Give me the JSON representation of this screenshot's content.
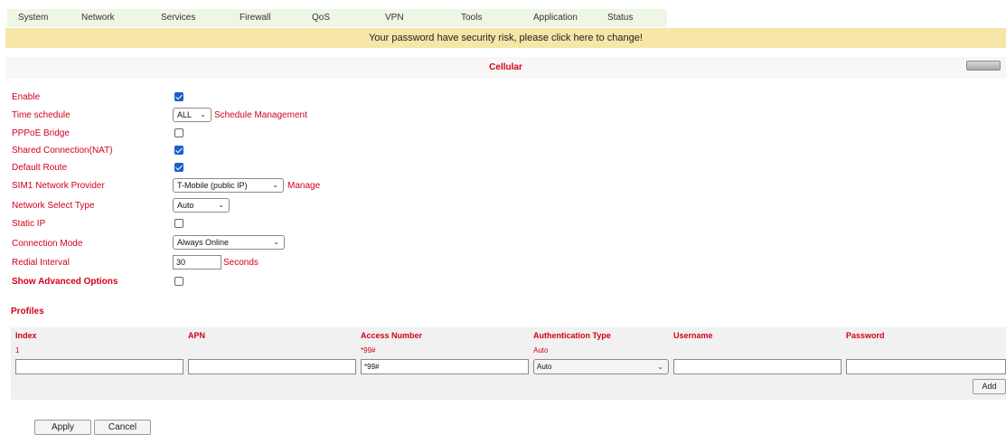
{
  "nav": {
    "items": [
      "System",
      "Network",
      "Services",
      "Firewall",
      "QoS",
      "VPN",
      "Tools",
      "Application",
      "Status"
    ]
  },
  "banner": {
    "text": "Your password have security risk, please click here to change!"
  },
  "section": {
    "title": "Cellular"
  },
  "form": {
    "enable": {
      "label": "Enable",
      "checked": true
    },
    "time_schedule": {
      "label": "Time schedule",
      "value": "ALL",
      "link": "Schedule Management"
    },
    "pppoe_bridge": {
      "label": "PPPoE Bridge",
      "checked": false
    },
    "shared_connection": {
      "label": "Shared Connection(NAT)",
      "checked": true
    },
    "default_route": {
      "label": "Default Route",
      "checked": true
    },
    "sim1_provider": {
      "label": "SIM1 Network Provider",
      "value": "T-Mobile (public IP)",
      "link": "Manage"
    },
    "network_select_type": {
      "label": "Network Select Type",
      "value": "Auto"
    },
    "static_ip": {
      "label": "Static IP",
      "checked": false
    },
    "connection_mode": {
      "label": "Connection Mode",
      "value": "Always Online"
    },
    "redial_interval": {
      "label": "Redial Interval",
      "value": "30",
      "unit": "Seconds"
    },
    "show_advanced": {
      "label": "Show Advanced Options",
      "checked": false
    }
  },
  "profiles": {
    "title": "Profiles",
    "columns": [
      "Index",
      "APN",
      "Access Number",
      "Authentication Type",
      "Username",
      "Password"
    ],
    "rows": [
      {
        "index": "1",
        "apn": "",
        "access_number": "*99#",
        "auth_type": "Auto",
        "username": "",
        "password": ""
      }
    ],
    "new_row": {
      "index": "",
      "apn": "",
      "access_number": "*99#",
      "auth_type": "Auto",
      "username": "",
      "password": ""
    },
    "add_label": "Add"
  },
  "actions": {
    "apply_label": "Apply",
    "cancel_label": "Cancel"
  },
  "colors": {
    "label_red": "#d2001a",
    "banner_bg": "#f6e6a7",
    "nav_bg": "#eef6e4",
    "checkbox_blue": "#1a5fd0"
  }
}
